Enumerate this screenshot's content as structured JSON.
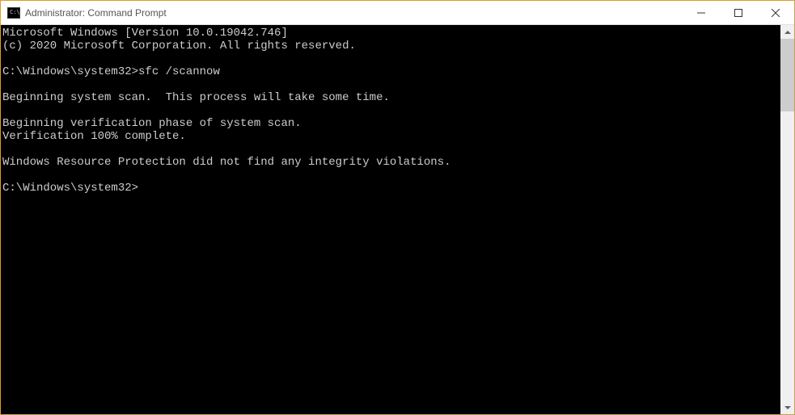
{
  "window": {
    "title": "Administrator: Command Prompt",
    "icon_text": "C:\\"
  },
  "terminal": {
    "lines": [
      "Microsoft Windows [Version 10.0.19042.746]",
      "(c) 2020 Microsoft Corporation. All rights reserved.",
      "",
      "C:\\Windows\\system32>sfc /scannow",
      "",
      "Beginning system scan.  This process will take some time.",
      "",
      "Beginning verification phase of system scan.",
      "Verification 100% complete.",
      "",
      "Windows Resource Protection did not find any integrity violations.",
      "",
      "C:\\Windows\\system32>"
    ]
  }
}
